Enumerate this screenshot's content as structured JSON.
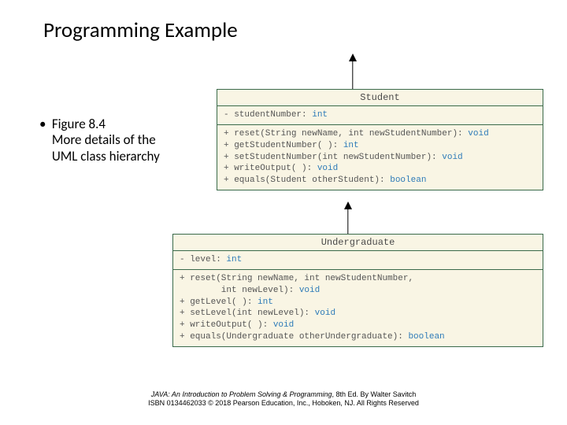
{
  "title": "Programming Example",
  "bullet": {
    "line1": "Figure 8.4",
    "line2": "More details of the UML class hierarchy"
  },
  "student": {
    "name": "Student",
    "attrs": "- studentNumber: <span class=\"t-type\">int</span>",
    "ops": "+ reset(String newName, int newStudentNumber): <span class=\"t-type\">void</span>\n+ getStudentNumber( ): <span class=\"t-type\">int</span>\n+ setStudentNumber(int newStudentNumber): <span class=\"t-type\">void</span>\n+ writeOutput( ): <span class=\"t-type\">void</span>\n+ equals(Student otherStudent): <span class=\"t-type\">boolean</span>"
  },
  "undergrad": {
    "name": "Undergraduate",
    "attrs": "- level: <span class=\"t-type\">int</span>",
    "ops": "+ reset(String newName, int newStudentNumber,\n        int newLevel): <span class=\"t-type\">void</span>\n+ getLevel( ): <span class=\"t-type\">int</span>\n+ setLevel(int newLevel): <span class=\"t-type\">void</span>\n+ writeOutput( ): <span class=\"t-type\">void</span>\n+ equals(Undergraduate otherUndergraduate): <span class=\"t-type\">boolean</span>"
  },
  "footer": {
    "line1a": "JAVA: An Introduction to Problem Solving & Programming",
    "line1b": ", 8th Ed. By Walter Savitch",
    "line2": "ISBN 0134462033 © 2018 Pearson Education, Inc., Hoboken, NJ. All Rights Reserved"
  }
}
